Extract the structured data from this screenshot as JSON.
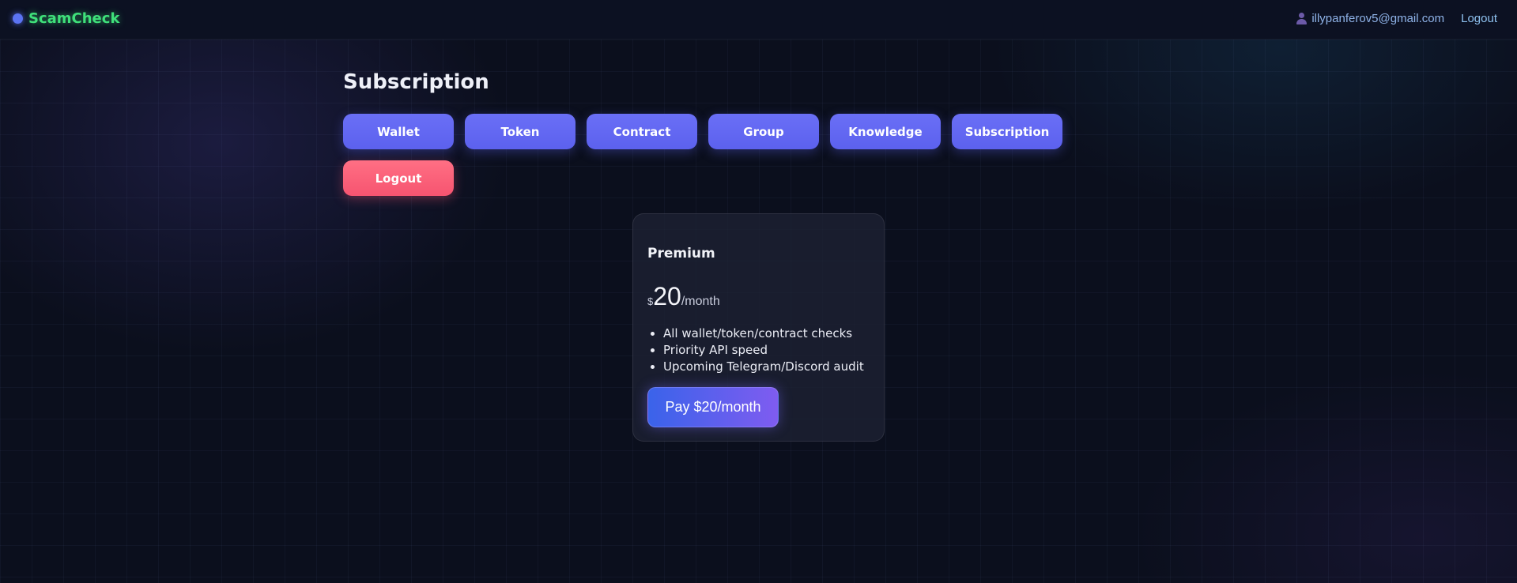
{
  "brand": {
    "name": "ScamCheck",
    "color": "#3fe07a"
  },
  "header": {
    "user_icon": "user-icon",
    "email": "illypanferov5@gmail.com",
    "logout_label": "Logout"
  },
  "main": {
    "title": "Subscription",
    "nav_buttons": [
      {
        "label": "Wallet"
      },
      {
        "label": "Token"
      },
      {
        "label": "Contract"
      },
      {
        "label": "Group"
      },
      {
        "label": "Knowledge"
      },
      {
        "label": "Subscription"
      }
    ],
    "logout_button": {
      "label": "Logout",
      "color": "#f65470"
    }
  },
  "plan": {
    "name": "Premium",
    "currency": "$",
    "amount": "20",
    "period": "/month",
    "features": [
      "All wallet/token/contract checks",
      "Priority API speed",
      "Upcoming Telegram/Discord audit"
    ],
    "pay_label": "Pay $20/month"
  },
  "colors": {
    "accent": "#6a6ff6",
    "danger": "#f65470",
    "background": "#0b0f1d"
  }
}
